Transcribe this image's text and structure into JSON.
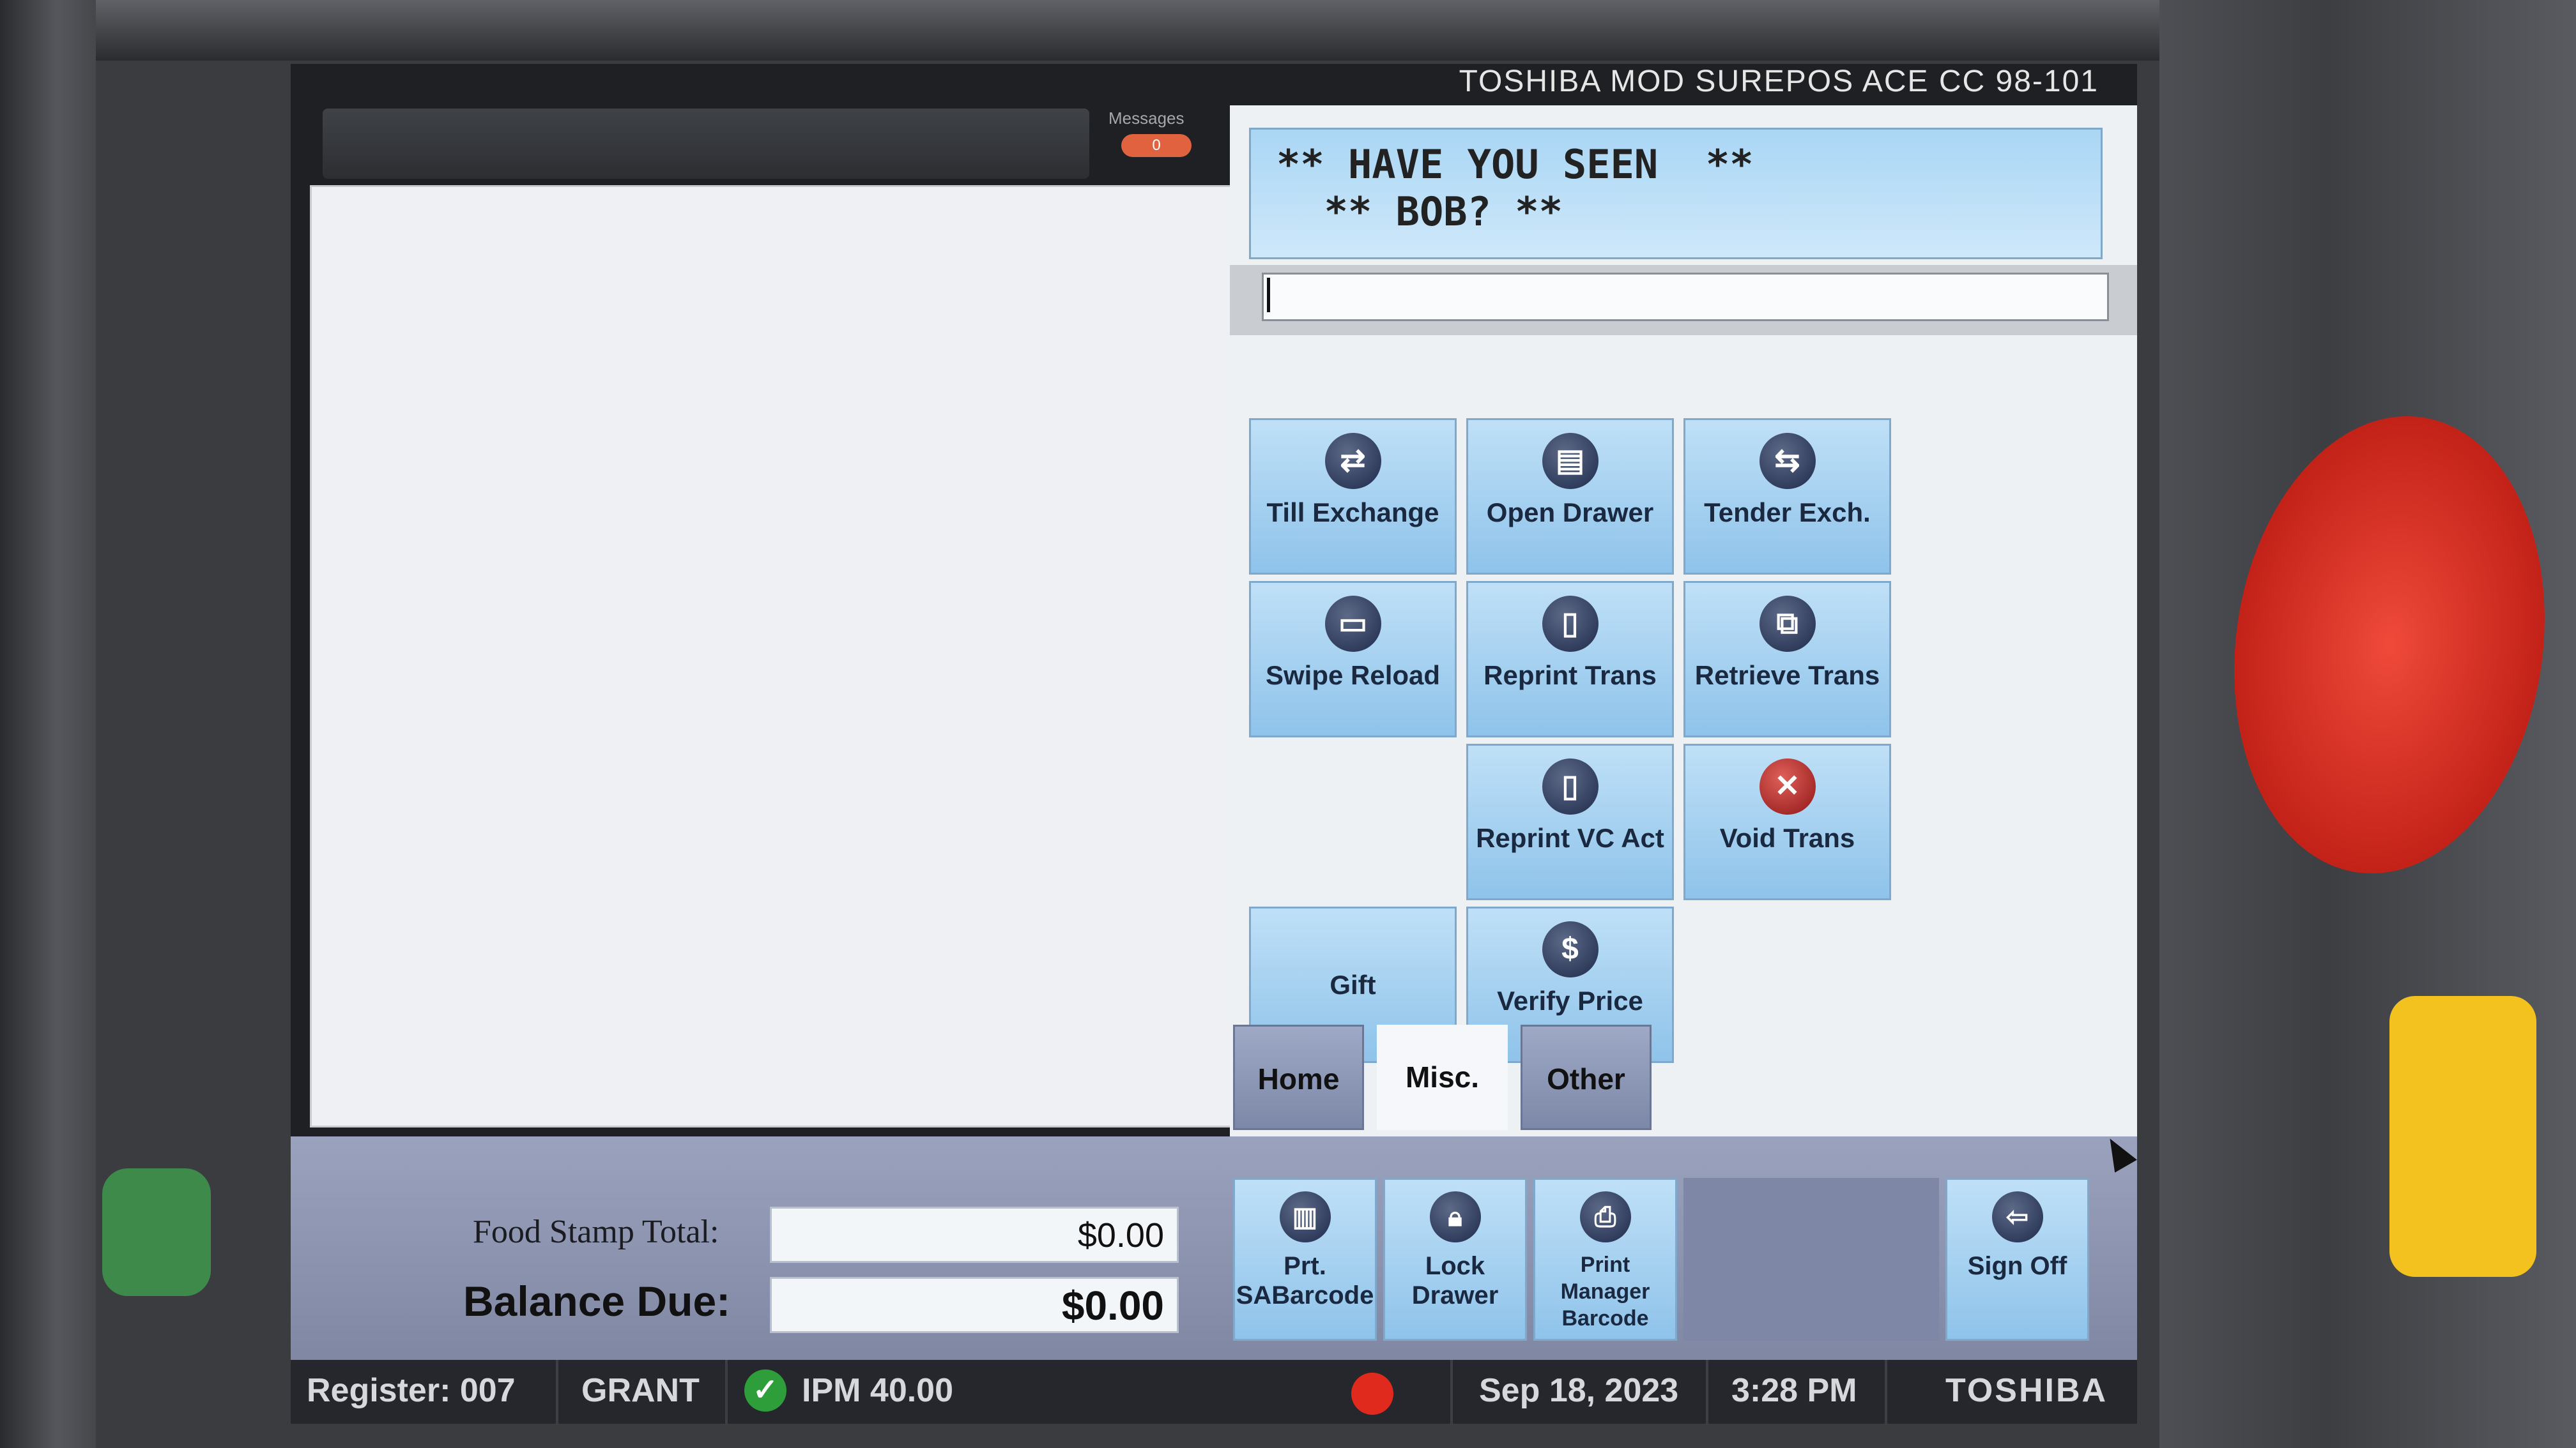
{
  "device": {
    "model_text": "TOSHIBA MOD SUREPOS ACE CC 98-101"
  },
  "messages": {
    "label": "Messages",
    "count": "0"
  },
  "marquee": {
    "line1": "** HAVE YOU SEEN  **",
    "line2": "  ** BOB? **"
  },
  "buttons": [
    {
      "label": "Till Exchange",
      "icon": "till-exchange-icon"
    },
    {
      "label": "Open Drawer",
      "icon": "open-drawer-icon"
    },
    {
      "label": "Tender Exch.",
      "icon": "tender-exchange-icon"
    },
    {
      "label": "Swipe Reload",
      "icon": "card-icon"
    },
    {
      "label": "Reprint Trans",
      "icon": "receipt-icon"
    },
    {
      "label": "Retrieve Trans",
      "icon": "retrieve-icon"
    },
    {
      "label": "Reprint VC Act",
      "icon": "receipt-icon"
    },
    {
      "label": "Void Trans",
      "icon": "x-icon"
    },
    {
      "label": "Gift",
      "icon": ""
    },
    {
      "label": "Verify Price",
      "icon": "price-check-icon"
    }
  ],
  "tabs": [
    {
      "label": "Home",
      "active": false
    },
    {
      "label": "Misc.",
      "active": true
    },
    {
      "label": "Other",
      "active": false
    }
  ],
  "totals": {
    "food_stamp_label": "Food Stamp Total:",
    "food_stamp_value": "$0.00",
    "balance_label": "Balance Due:",
    "balance_value": "$0.00"
  },
  "bottom_buttons": [
    {
      "label": "Prt. SABarcode",
      "icon": "barcode-icon"
    },
    {
      "label": "Lock Drawer",
      "icon": "lock-icon"
    },
    {
      "label": "Print Manager Barcode",
      "icon": "printer-icon"
    },
    {
      "label": "Sign Off",
      "icon": "sign-off-icon"
    }
  ],
  "status": {
    "register": "Register: 007",
    "operator": "GRANT",
    "ipm": "IPM 40.00",
    "date": "Sep 18, 2023",
    "time": "3:28 PM",
    "brand": "TOSHIBA"
  },
  "colors": {
    "button_blue": "#a8d2f1",
    "tab_inactive": "#8c97b7",
    "status_ok": "#2e9e3b",
    "status_alert": "#e02a1d"
  }
}
